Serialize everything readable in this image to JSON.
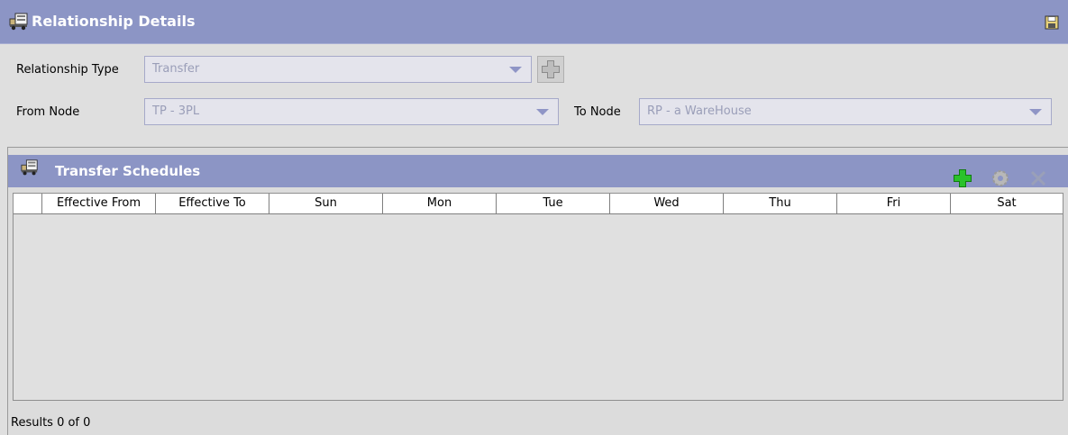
{
  "window": {
    "title": "Relationship Details",
    "title_icon": "truck-icon",
    "save_icon": "save-icon"
  },
  "form": {
    "relationship_type_label": "Relationship Type",
    "relationship_type_value": "Transfer",
    "from_node_label": "From Node",
    "from_node_value": "TP - 3PL",
    "to_node_label": "To Node",
    "to_node_value": "RP - a WareHouse"
  },
  "schedules": {
    "title": "Transfer Schedules",
    "icon": "truck-icon",
    "actions": [
      "add-icon",
      "settings-icon",
      "delete-icon"
    ],
    "columns": [
      "",
      "Effective From",
      "Effective To",
      "Sun",
      "Mon",
      "Tue",
      "Wed",
      "Thu",
      "Fri",
      "Sat"
    ],
    "rows": [],
    "results_text": "Results 0 of 0"
  },
  "colors": {
    "header_bar": "#8c95c5",
    "add_green": "#1aa21a",
    "combo_text": "#9a9eb8"
  }
}
